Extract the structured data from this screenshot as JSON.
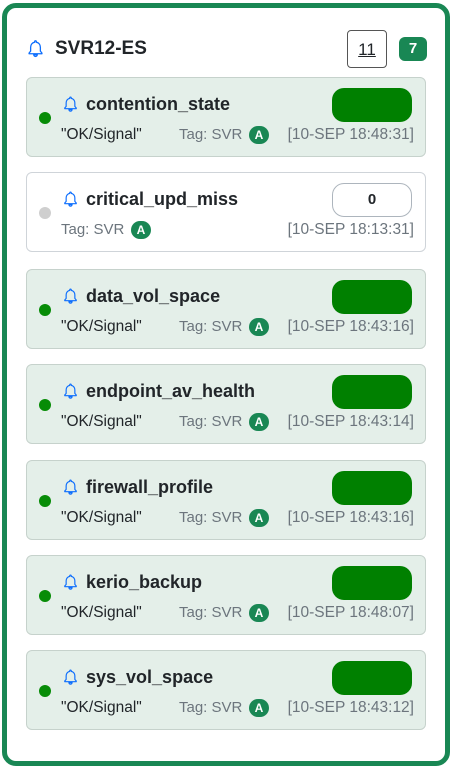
{
  "header": {
    "title": "SVR12-ES",
    "count_box": "11",
    "count_badge": "7"
  },
  "colors": {
    "panel_border": "#198754",
    "ok_fill": "#008000",
    "ok_dot": "#078c07",
    "idle_dot": "#cfcfcf",
    "card_bg": "#e4efe9"
  },
  "icons": {
    "header": "bell-icon",
    "card": "bell-icon"
  },
  "cards": [
    {
      "name": "contention_state",
      "value_text": "\"OK/Signal\"",
      "tag": "Tag: SVR",
      "tag_badge": "A",
      "timestamp": "[10-SEP 18:48:31]",
      "state": "ok",
      "pill": ""
    },
    {
      "name": "critical_upd_miss",
      "value_text": "",
      "tag": "Tag: SVR",
      "tag_badge": "A",
      "timestamp": "[10-SEP 18:13:31]",
      "state": "idle",
      "pill": "0"
    },
    {
      "name": "data_vol_space",
      "value_text": "\"OK/Signal\"",
      "tag": "Tag: SVR",
      "tag_badge": "A",
      "timestamp": "[10-SEP 18:43:16]",
      "state": "ok",
      "pill": ""
    },
    {
      "name": "endpoint_av_health",
      "value_text": "\"OK/Signal\"",
      "tag": "Tag: SVR",
      "tag_badge": "A",
      "timestamp": "[10-SEP 18:43:14]",
      "state": "ok",
      "pill": ""
    },
    {
      "name": "firewall_profile",
      "value_text": "\"OK/Signal\"",
      "tag": "Tag: SVR",
      "tag_badge": "A",
      "timestamp": "[10-SEP 18:43:16]",
      "state": "ok",
      "pill": ""
    },
    {
      "name": "kerio_backup",
      "value_text": "\"OK/Signal\"",
      "tag": "Tag: SVR",
      "tag_badge": "A",
      "timestamp": "[10-SEP 18:48:07]",
      "state": "ok",
      "pill": ""
    },
    {
      "name": "sys_vol_space",
      "value_text": "\"OK/Signal\"",
      "tag": "Tag: SVR",
      "tag_badge": "A",
      "timestamp": "[10-SEP 18:43:12]",
      "state": "ok",
      "pill": ""
    }
  ]
}
